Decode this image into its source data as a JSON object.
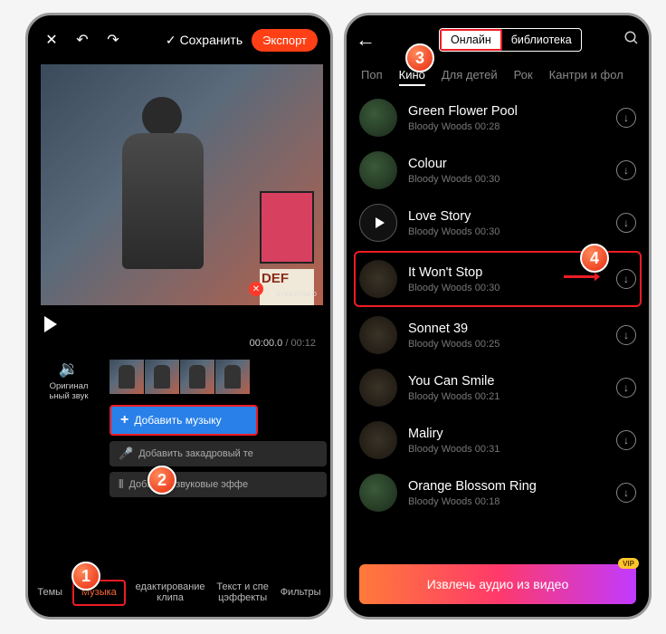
{
  "leftPhone": {
    "topbar": {
      "close": "✕",
      "undo": "↶",
      "redo": "↷",
      "save_icon": "✓",
      "save_label": "Сохранить",
      "export_label": "Экспорт"
    },
    "preview": {
      "poster2_text": "DEF",
      "watermark_close": "✕",
      "watermark": "VIVAVIDEO"
    },
    "timecode": {
      "current": "00:00.0",
      "sep": " / ",
      "total": "00:12"
    },
    "original_sound": {
      "label_line1": "Оригинал",
      "label_line2": "ьный звук"
    },
    "buttons": {
      "add_music": "Добавить музыку",
      "add_voiceover_icon": "🎤",
      "add_voiceover": "Добавить закадровый те",
      "add_sfx_icon": "⫴",
      "add_sfx": "Добавить звуковые эффе"
    },
    "bottom_tabs": {
      "themes": "Темы",
      "music": "Музыка",
      "edit_line1": "едактирование",
      "edit_line2": "клипа",
      "text_line1": "Текст и спе",
      "text_line2": "цэффекты",
      "filters": "Фильтры"
    }
  },
  "rightPhone": {
    "topbar": {
      "back": "←",
      "seg_online": "Онлайн",
      "seg_library": "библиотека"
    },
    "genres": {
      "pop": "Поп",
      "cinema": "Кино",
      "kids": "Для детей",
      "rock": "Рок",
      "country": "Кантри и фол"
    },
    "tracks": [
      {
        "title": "Green Flower Pool",
        "artist": "Bloody Woods",
        "duration": "00:28",
        "cover": "green"
      },
      {
        "title": "Colour",
        "artist": "Bloody Woods",
        "duration": "00:30",
        "cover": "green"
      },
      {
        "title": "Love Story",
        "artist": "Bloody Woods",
        "duration": "00:30",
        "cover": "play"
      },
      {
        "title": "It Won't Stop",
        "artist": "Bloody Woods",
        "duration": "00:30",
        "cover": "dark",
        "highlighted": true
      },
      {
        "title": "Sonnet 39",
        "artist": "Bloody Woods",
        "duration": "00:25",
        "cover": "dark"
      },
      {
        "title": "You Can Smile",
        "artist": "Bloody Woods",
        "duration": "00:21",
        "cover": "dark"
      },
      {
        "title": "Maliry",
        "artist": "Bloody Woods",
        "duration": "00:31",
        "cover": "dark"
      },
      {
        "title": "Orange Blossom Ring",
        "artist": "Bloody Woods",
        "duration": "00:18",
        "cover": "green"
      }
    ],
    "extract": {
      "label": "Извлечь аудио из видео",
      "vip": "VIP"
    }
  },
  "steps": {
    "s1": "1",
    "s2": "2",
    "s3": "3",
    "s4": "4"
  }
}
